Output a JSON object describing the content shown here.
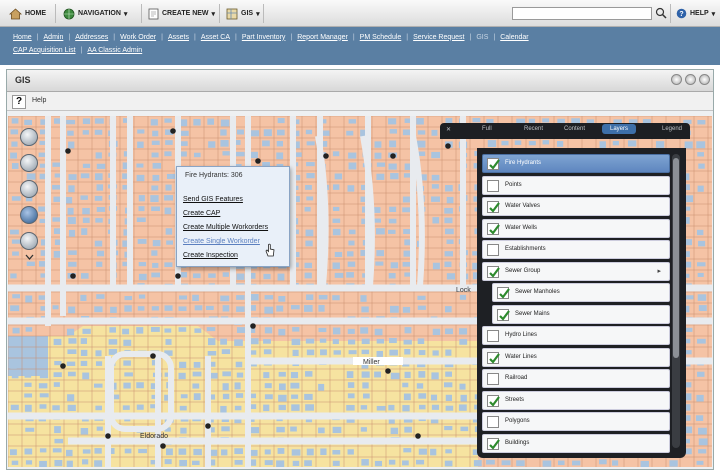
{
  "toolbar": {
    "home": "HOME",
    "navigation": "NAVIGATION",
    "create_new": "CREATE NEW",
    "gis": "GIS",
    "help": "HELP",
    "search_placeholder": ""
  },
  "nav": {
    "row1": [
      "Home",
      "Admin",
      "Addresses",
      "Work Order",
      "Assets",
      "Asset CA",
      "Part Inventory",
      "Report Manager",
      "PM Schedule",
      "Service Request",
      "GIS",
      "Calendar"
    ],
    "row2": [
      "CAP Acquisition List",
      "AA Classic Admin"
    ]
  },
  "panel": {
    "title": "GIS",
    "help_label": "Help"
  },
  "map": {
    "street_labels": [
      "Miller",
      "Eldorado",
      "Lock"
    ]
  },
  "popup": {
    "title": "Fire Hydrants: 306",
    "items": [
      "Send GIS Features",
      "Create CAP",
      "Create Multiple Workorders",
      "Create Single Workorder",
      "Create Inspection"
    ]
  },
  "layers_panel": {
    "tabs": [
      "Full",
      "Recent",
      "Content",
      "Layers",
      "Legend"
    ],
    "active_tab": "Layers",
    "items": [
      {
        "label": "Fire Hydrants",
        "checked": true,
        "selected": true
      },
      {
        "label": "Points",
        "checked": false
      },
      {
        "label": "Water Valves",
        "checked": true
      },
      {
        "label": "Water Wells",
        "checked": true
      },
      {
        "label": "Establishments",
        "checked": false
      },
      {
        "label": "Sewer Group",
        "checked": true,
        "expandable": true
      },
      {
        "label": "Sewer Manholes",
        "checked": true,
        "indent": true
      },
      {
        "label": "Sewer Mains",
        "checked": true,
        "indent": true
      },
      {
        "label": "Hydro Lines",
        "checked": false
      },
      {
        "label": "Water Lines",
        "checked": true
      },
      {
        "label": "Railroad",
        "checked": false
      },
      {
        "label": "Streets",
        "checked": true
      },
      {
        "label": "Polygons",
        "checked": false
      },
      {
        "label": "Buildings",
        "checked": true
      }
    ]
  },
  "colors": {
    "nav_bg": "#5a7fa3",
    "parcel": "#f5c3a5",
    "building": "#a9c4df",
    "road": "#e8ebef",
    "subdivision": "#f6e3a0",
    "active_tab": "#3d6fa8",
    "check": "#2e8b2e"
  }
}
